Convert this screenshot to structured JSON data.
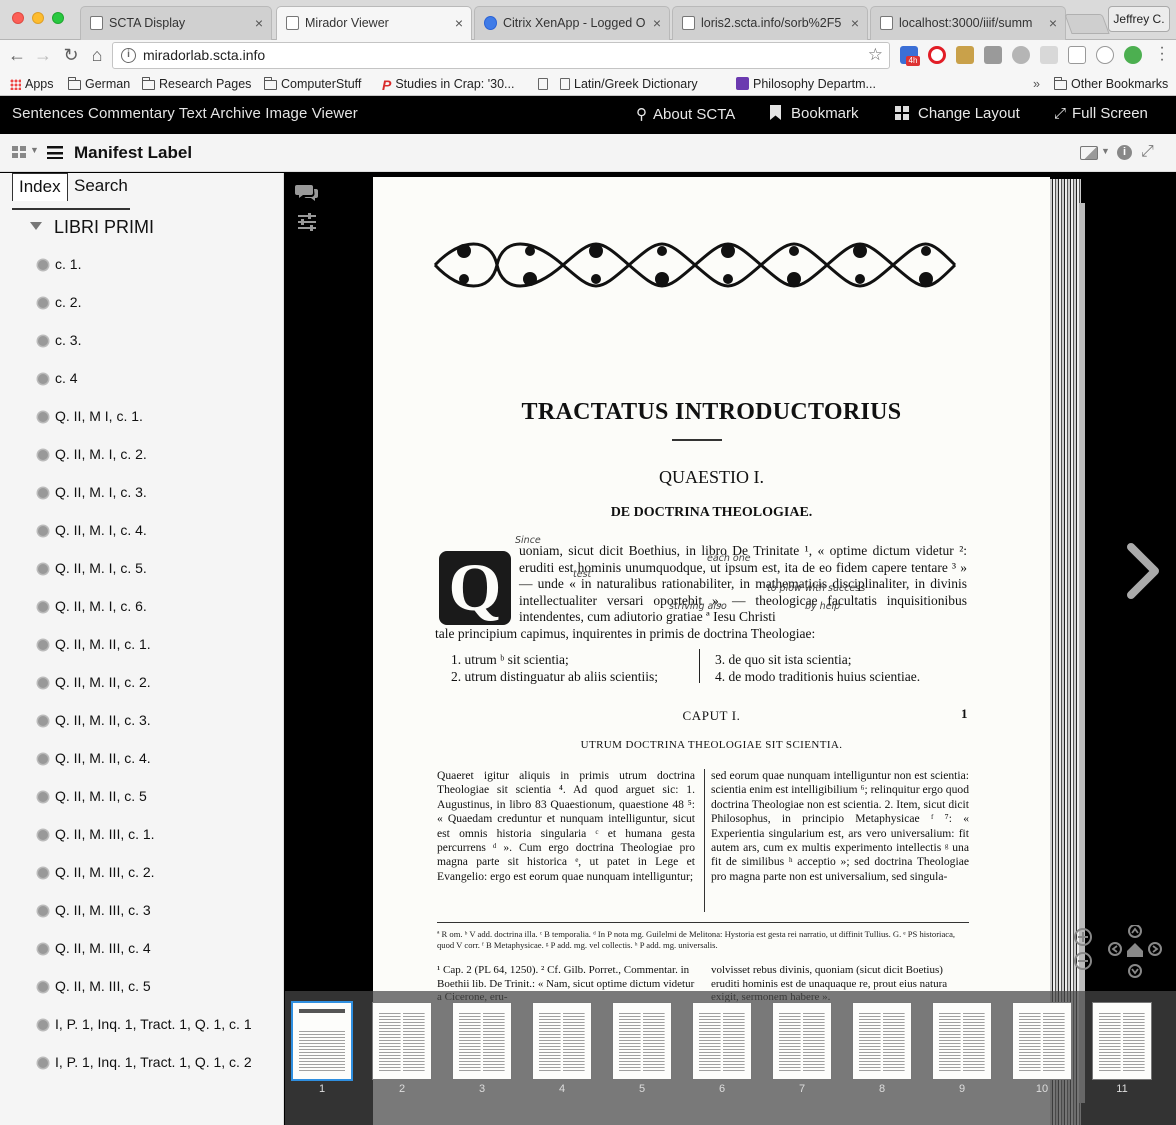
{
  "browser": {
    "tabs": [
      {
        "title": "SCTA Display",
        "icon": "page-icon",
        "active": false
      },
      {
        "title": "Mirador Viewer",
        "icon": "page-icon",
        "active": true
      },
      {
        "title": "Citrix XenApp - Logged O",
        "icon": "citrix-icon",
        "active": false
      },
      {
        "title": "loris2.scta.info/sorb%2F5",
        "icon": "page-icon",
        "active": false
      },
      {
        "title": "localhost:3000/iiif/summ",
        "icon": "page-icon",
        "active": false
      }
    ],
    "close_glyph": "×",
    "profile_name": "Jeffrey C.",
    "url": "miradorlab.scta.info",
    "extension_badge": "4h",
    "bookmarks": [
      {
        "label": "Apps",
        "icon": "apps-icon"
      },
      {
        "label": "German",
        "icon": "folder-icon"
      },
      {
        "label": "Research Pages",
        "icon": "folder-icon"
      },
      {
        "label": "ComputerStuff",
        "icon": "folder-icon"
      },
      {
        "label": "Studies in Crap: '30...",
        "icon": "p-icon"
      },
      {
        "label": "",
        "icon": "page-icon"
      },
      {
        "label": "Latin/Greek Dictionary",
        "icon": "page-icon"
      },
      {
        "label": "Philosophy Departm...",
        "icon": "philosophy-icon"
      }
    ],
    "bookmarks_overflow": "»",
    "other_bookmarks": "Other Bookmarks"
  },
  "app": {
    "title": "Sentences Commentary Text Archive Image Viewer",
    "nav": {
      "about": "About SCTA",
      "bookmark": "Bookmark",
      "change_layout": "Change Layout",
      "full_screen": "Full Screen"
    }
  },
  "window": {
    "manifest_label": "Manifest Label"
  },
  "sidebar": {
    "tabs": {
      "index": "Index",
      "search": "Search"
    },
    "root": "LIBRI PRIMI",
    "items": [
      "c. 1.",
      "c. 2.",
      "c. 3.",
      "c. 4",
      "Q. II, M I, c. 1.",
      "Q. II, M. I, c. 2.",
      "Q. II, M. I, c. 3.",
      "Q. II, M. I, c. 4.",
      "Q. II, M. I, c. 5.",
      "Q. II, M. I, c. 6.",
      "Q. II, M. II, c. 1.",
      "Q. II, M. II, c. 2.",
      "Q. II, M. II, c. 3.",
      "Q. II, M. II, c. 4.",
      "Q. II, M. II, c. 5",
      "Q. II, M. III, c. 1.",
      "Q. II, M. III, c. 2.",
      "Q. II, M. III, c. 3",
      "Q. II, M. III, c. 4",
      "Q. II, M. III, c. 5",
      "I, P. 1, Inq. 1, Tract. 1, Q. 1, c. 1",
      "I, P. 1, Inq. 1, Tract. 1, Q. 1, c. 2"
    ]
  },
  "page": {
    "title": "TRACTATUS INTRODUCTORIUS",
    "question": "QUAESTIO I.",
    "subtitle": "DE DOCTRINA THEOLOGIAE.",
    "dropcap": "Q",
    "intro": "uoniam, sicut dicit Boethius, in libro De Trinitate ¹, « optime dictum videtur ²: eruditi est hominis unumquodque, ut ipsum est, ita de eo fidem capere tentare ³ » — unde « in naturalibus rationabiliter, in mathematicis disciplinaliter, in divinis intellectualiter versari oportebit », — theologicae facultatis inquisitionibus intendentes, cum adiutorio gratiae ª Iesu Christi",
    "intro_tail": "tale principium capimus, inquirentes in primis de doctrina Theologiae:",
    "list_left": [
      "1. utrum ᵇ sit scientia;",
      "2. utrum distinguatur ab aliis scientiis;"
    ],
    "list_right": [
      "3. de quo sit ista scientia;",
      "4. de modo traditionis huius scientiae."
    ],
    "annotations": [
      "Since",
      "each one",
      "test",
      "to plow with success",
      "striving also",
      "by help"
    ],
    "caput": "CAPUT I.",
    "caput_sub": "UTRUM DOCTRINA THEOLOGIAE SIT SCIENTIA.",
    "page_number": "1",
    "col_left": "Quaeret igitur aliquis in primis utrum doctrina Theologiae sit scientia ⁴. Ad quod arguet sic: 1. Augustinus, in libro 83 Quaestionum, quaestione 48 ⁵: « Quaedam creduntur et nunquam intelliguntur, sicut est omnis historia singularia ᶜ et humana gesta percurrens ᵈ ». Cum ergo doctrina Theologiae pro magna parte sit historica ᵉ, ut patet in Lege et Evangelio: ergo est eorum quae nunquam intelliguntur;",
    "col_right": "sed eorum quae nunquam intelliguntur non est scientia: scientia enim est intelligibilium ⁶; relinquitur ergo quod doctrina Theologiae non est scientia. 2. Item, sicut dicit Philosophus, in principio Metaphysicae ᶠ ⁷: « Experientia singularium est, ars vero universalium: fit autem ars, cum ex multis experimento intellectis ᵍ una fit de similibus ʰ acceptio »; sed doctrina Theologiae pro magna parte non est universalium, sed singula-",
    "footnotes": "ª R om. ᵇ V add. doctrina illa. ᶜ B temporalia. ᵈ In P nota mg. Guilelmi de Melitona: Hystoria est gesta rei narratio, ut diffinit Tullius. G. ᵉ PS historiaca, quod V corr. ᶠ B Metaphysicae. ᵍ P add. mg. vel collectis. ʰ P add. mg. universalis.",
    "refs_left": "¹ Cap. 2 (PL 64, 1250). ² Cf. Gilb. Porret., Commentar. in Boethii lib. De Trinit.: « Nam, sicut optime dictum videtur a Cicerone, eru-",
    "refs_right": "volvisset rebus divinis, quoniam (sicut dicit Boetius) eruditi hominis est de unaquaque re, prout eius natura exigit, sermonem habere »."
  },
  "thumbnails": [
    "1",
    "2",
    "3",
    "4",
    "5",
    "6",
    "7",
    "8",
    "9",
    "10",
    "11"
  ],
  "colors": {
    "app_header_bg": "#000000",
    "thumb_active": "#2f8fe0",
    "sidebar_bg": "#f5f5f5"
  }
}
